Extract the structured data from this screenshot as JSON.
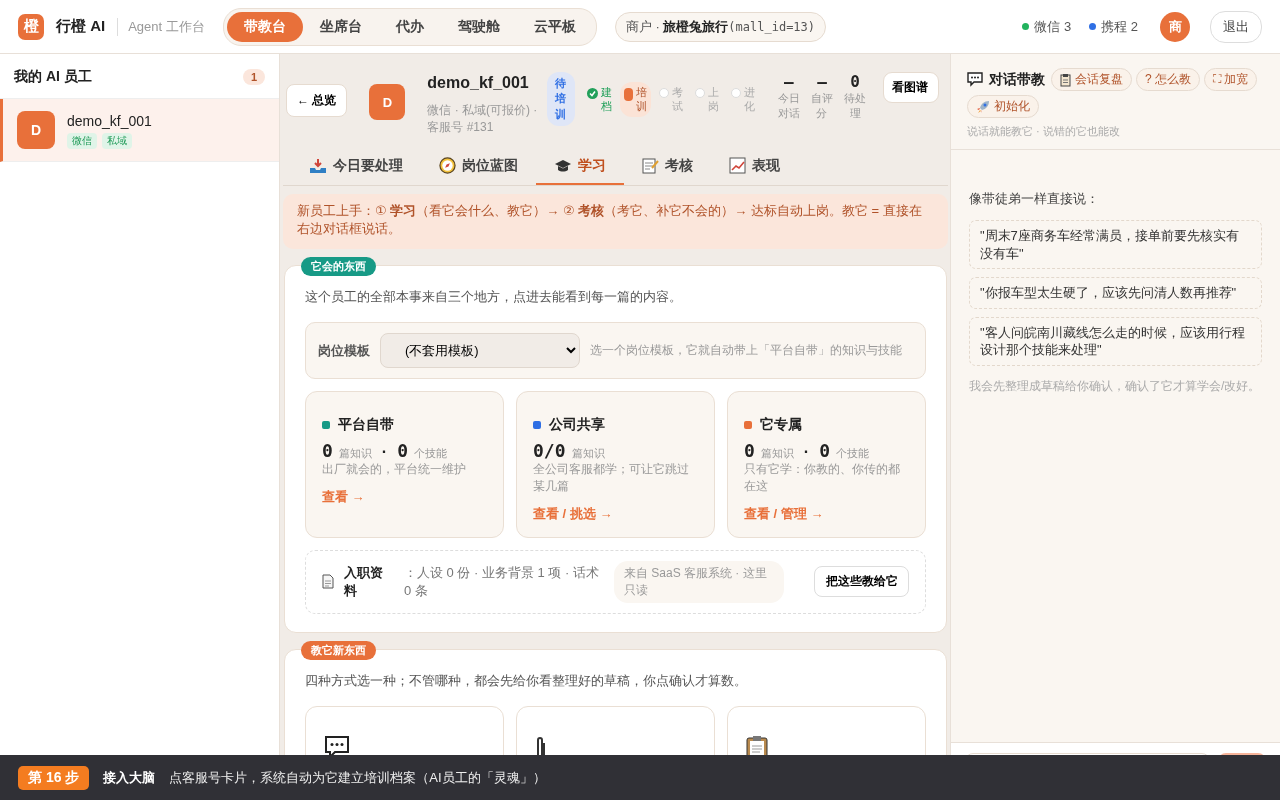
{
  "brand": {
    "logo": "橙",
    "name": "行橙 AI",
    "subtitle": "Agent 工作台"
  },
  "nav": [
    {
      "label": "带教台",
      "selected": true
    },
    {
      "label": "坐席台",
      "selected": false
    },
    {
      "label": "代办",
      "selected": false
    },
    {
      "label": "驾驶舱",
      "selected": false
    },
    {
      "label": "云平板",
      "selected": false
    }
  ],
  "merchant": {
    "prefix": "商户 · ",
    "name": "旅橙兔旅行",
    "id": "(mall_id=13)"
  },
  "channels": [
    {
      "name": "微信",
      "count": "3",
      "color": "#22b35e"
    },
    {
      "name": "携程",
      "count": "2",
      "color": "#2f6fe4"
    }
  ],
  "user": {
    "avatar": "商",
    "logout": "退出"
  },
  "sidebar": {
    "title": "我的 AI 员工",
    "count": "1",
    "employees": [
      {
        "avatar": "D",
        "name": "demo_kf_001",
        "tags": [
          "微信",
          "私域"
        ],
        "selected": true
      }
    ]
  },
  "agent": {
    "back": "← 总览",
    "avatar": "D",
    "name": "demo_kf_001",
    "status": "待培训",
    "sub": "微信 · 私域(可报价) · 客服号 #131",
    "stages": [
      {
        "label": "建档",
        "kind": "done"
      },
      {
        "label": "培训",
        "kind": "current"
      },
      {
        "label": "考试",
        "kind": "todo"
      },
      {
        "label": "上岗",
        "kind": "todo"
      },
      {
        "label": "进化",
        "kind": "todo"
      }
    ],
    "stats": [
      {
        "value": "–",
        "label": "今日对话"
      },
      {
        "value": "–",
        "label": "自评分"
      },
      {
        "value": "0",
        "label": "待处理"
      }
    ],
    "graph_button": "看图谱"
  },
  "tabs": [
    {
      "label": "今日要处理",
      "selected": false
    },
    {
      "label": "岗位蓝图",
      "selected": false
    },
    {
      "label": "学习",
      "selected": true
    },
    {
      "label": "考核",
      "selected": false
    },
    {
      "label": "表现",
      "selected": false
    }
  ],
  "notice": "新员工上手：① **学习**（看它会什么、教它）→ ② **考核**（考它、补它不会的）→ 达标自动上岗。教它 = 直接在右边对话框说话。",
  "knowledge": {
    "badge": "它会的东西",
    "intro": "这个员工的全部本事来自三个地方，点进去能看到每一篇的内容。",
    "template": {
      "label": "岗位模板",
      "value": "(不套用模板)",
      "hint": "选一个岗位模板，它就自动带上「平台自带」的知识与技能"
    },
    "sources": [
      {
        "title": "平台自带",
        "color": "#179a86",
        "separator": "·",
        "counts": [
          {
            "value": "0",
            "unit": "篇知识"
          },
          {
            "value": "0",
            "unit": "个技能"
          }
        ],
        "desc": "出厂就会的，平台统一维护",
        "link": "查看 →"
      },
      {
        "title": "公司共享",
        "color": "#2f6fe4",
        "counts": [
          {
            "value": "0/0",
            "unit": "篇知识"
          }
        ],
        "desc": "全公司客服都学；可让它跳过某几篇",
        "link": "查看 / 挑选 →"
      },
      {
        "title": "它专属",
        "color": "#e8703a",
        "separator": "·",
        "counts": [
          {
            "value": "0",
            "unit": "篇知识"
          },
          {
            "value": "0",
            "unit": "个技能"
          }
        ],
        "desc": "只有它学：你教的、你传的都在这",
        "link": "查看 / 管理 →"
      }
    ],
    "onboarding": {
      "title": "入职资料",
      "detail": "：人设 0 份 · 业务背景 1 项 · 话术 0 条",
      "note": "来自 SaaS 客服系统 · 这里只读",
      "button": "把这些教给它"
    }
  },
  "teach": {
    "badge": "教它新东西",
    "intro": "四种方式选一种；不管哪种，都会先给你看整理好的草稿，你点确认才算数。",
    "methods": [
      {
        "kind": "chat"
      },
      {
        "kind": "doc"
      },
      {
        "kind": "flow"
      }
    ]
  },
  "chat": {
    "title": "对话带教",
    "actions": [
      {
        "label": "会话复盘"
      },
      {
        "label": "? 怎么教"
      },
      {
        "label": "⛶ 加宽"
      },
      {
        "label": "初始化"
      }
    ],
    "subtitle": "说话就能教它 · 说错的它也能改",
    "prompt": "像带徒弟一样直接说：",
    "examples": [
      "\"周末7座商务车经常满员，接单前要先核实有没有车\"",
      "\"你报车型太生硬了，应该先问清人数再推荐\"",
      "\"客人问皖南川藏线怎么走的时候，应该用行程设计那个技能来处理\""
    ],
    "footnote": "我会先整理成草稿给你确认，确认了它才算学会/改好。"
  },
  "step": {
    "badge": "第 16 步",
    "title": "接入大脑",
    "text": "点客服号卡片，系统自动为它建立培训档案（AI员工的「灵魂」）"
  }
}
